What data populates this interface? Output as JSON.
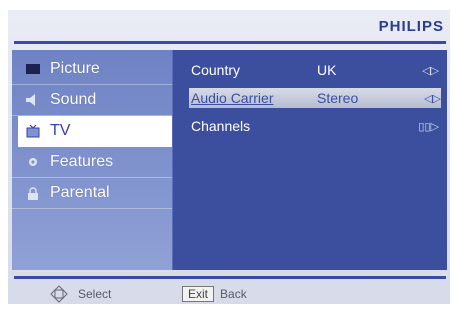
{
  "brand": "PHILIPS",
  "menu": {
    "items": [
      {
        "label": "Picture",
        "icon": "picture-icon"
      },
      {
        "label": "Sound",
        "icon": "speaker-icon"
      },
      {
        "label": "TV",
        "icon": "tv-icon"
      },
      {
        "label": "Features",
        "icon": "gear-icon"
      },
      {
        "label": "Parental",
        "icon": "lock-icon"
      }
    ],
    "selected": "TV"
  },
  "panel": {
    "rows": [
      {
        "label": "Country",
        "value": "UK",
        "arrows": "◁▷"
      },
      {
        "label": "Audio Carrier",
        "value": "Stereo",
        "arrows": "◁▷"
      },
      {
        "label": "Channels",
        "value": "",
        "arrows": "▯▯▷"
      }
    ],
    "highlighted": "Audio Carrier"
  },
  "footer": {
    "select_label": "Select",
    "exit_key": "Exit",
    "back_label": "Back"
  },
  "colors": {
    "accent": "#3a4aa8",
    "panel_bg": "#3c4f9e",
    "sidebar_bg": "#7f93cc",
    "brand": "#2c3c95"
  }
}
